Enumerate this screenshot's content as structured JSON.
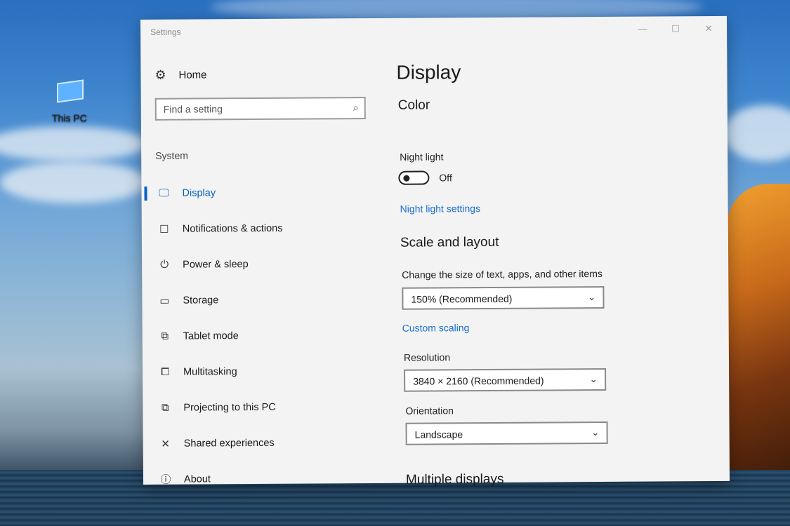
{
  "desktop": {
    "icon_label": "This PC"
  },
  "window": {
    "title": "Settings",
    "minimize_glyph": "—",
    "maximize_glyph": "☐",
    "close_glyph": "✕"
  },
  "sidebar": {
    "home_label": "Home",
    "home_icon": "gear-icon",
    "search_placeholder": "Find a setting",
    "section_label": "System",
    "items": [
      {
        "label": "Display",
        "icon": "monitor-icon",
        "glyph": "🖵",
        "active": true
      },
      {
        "label": "Notifications & actions",
        "icon": "notification-icon",
        "glyph": "☐"
      },
      {
        "label": "Power & sleep",
        "icon": "power-icon",
        "glyph": "⏻"
      },
      {
        "label": "Storage",
        "icon": "storage-icon",
        "glyph": "▭"
      },
      {
        "label": "Tablet mode",
        "icon": "tablet-icon",
        "glyph": "⧉"
      },
      {
        "label": "Multitasking",
        "icon": "multitasking-icon",
        "glyph": "⧠"
      },
      {
        "label": "Projecting to this PC",
        "icon": "projecting-icon",
        "glyph": "⧉"
      },
      {
        "label": "Shared experiences",
        "icon": "shared-icon",
        "glyph": "✕"
      },
      {
        "label": "About",
        "icon": "info-icon",
        "glyph": "ⓘ"
      }
    ]
  },
  "content": {
    "page_title": "Display",
    "color_heading": "Color",
    "night_light_label": "Night light",
    "night_light_state": "Off",
    "night_light_settings_link": "Night light settings",
    "scale_heading": "Scale and layout",
    "scale_label": "Change the size of text, apps, and other items",
    "scale_value": "150% (Recommended)",
    "custom_scaling_link": "Custom scaling",
    "resolution_label": "Resolution",
    "resolution_value": "3840 × 2160 (Recommended)",
    "orientation_label": "Orientation",
    "orientation_value": "Landscape",
    "multiple_displays_heading": "Multiple displays"
  },
  "colors": {
    "accent": "#0a63c4",
    "link": "#1a6fd0",
    "window_bg": "#f3f3f3"
  }
}
